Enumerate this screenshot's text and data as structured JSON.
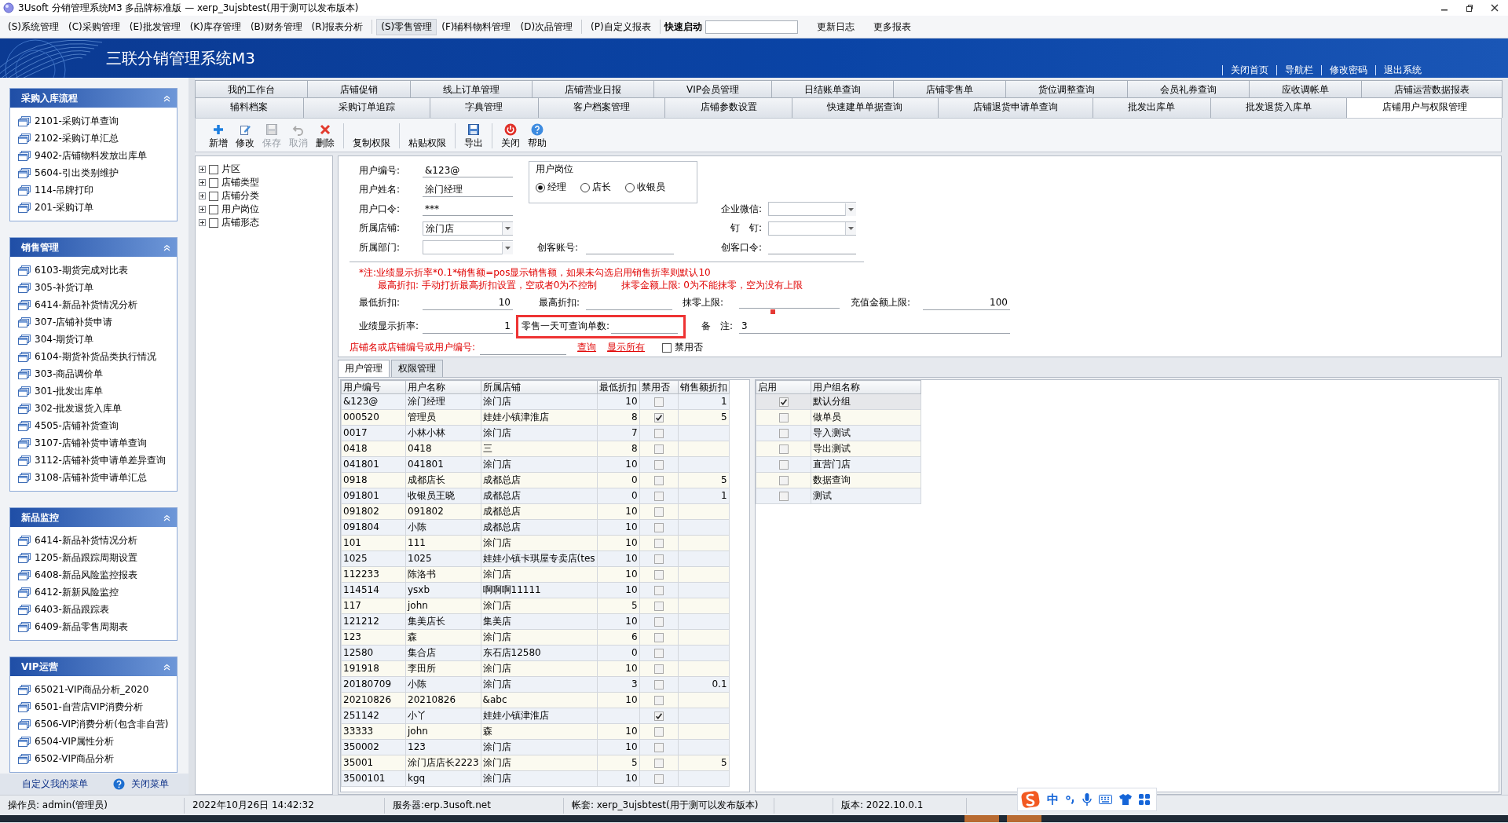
{
  "window": {
    "title": "3Usoft 分销管理系统M3 多品牌标准版 — xerp_3ujsbtest(用于测可以发布版本)"
  },
  "menu_groups": [
    {
      "items": [
        {
          "label": "(S)系统管理",
          "selected": false
        },
        {
          "label": "(C)采购管理",
          "selected": false
        },
        {
          "label": "(E)批发管理",
          "selected": false
        },
        {
          "label": "(K)库存管理",
          "selected": false
        },
        {
          "label": "(B)财务管理",
          "selected": false
        },
        {
          "label": "(R)报表分析",
          "selected": false
        }
      ]
    },
    {
      "items": [
        {
          "label": "(S)零售管理",
          "selected": true
        },
        {
          "label": "(F)辅料物料管理",
          "selected": false
        },
        {
          "label": "(D)次品管理",
          "selected": false
        }
      ]
    },
    {
      "items": [
        {
          "label": "(P)自定义报表",
          "selected": false
        }
      ]
    }
  ],
  "quick_launch": {
    "label": "快速启动"
  },
  "extra_links": [
    "更新日志",
    "更多报表"
  ],
  "header": {
    "title": "三联分销管理系统M3",
    "links": [
      "关闭首页",
      "导航栏",
      "修改密码",
      "退出系统"
    ]
  },
  "sidebar": {
    "panels": [
      {
        "title": "采购入库流程",
        "items": [
          "2101-采购订单查询",
          "2102-采购订单汇总",
          "9402-店铺物料发放出库单",
          "5604-引出类别维护",
          "114-吊牌打印",
          "201-采购订单"
        ]
      },
      {
        "title": "销售管理",
        "items": [
          "6103-期货完成对比表",
          "305-补货订单",
          "6414-新品补货情况分析",
          "307-店铺补货申请",
          "304-期货订单",
          "6104-期货补货品类执行情况",
          "303-商品调价单",
          "301-批发出库单",
          "302-批发退货入库单",
          "4505-店铺补货查询",
          "3107-店铺补货申请单查询",
          "3112-店铺补货申请单差异查询",
          "3108-店铺补货申请单汇总"
        ]
      },
      {
        "title": "新品监控",
        "items": [
          "6414-新品补货情况分析",
          "1205-新品跟踪周期设置",
          "6408-新品风险监控报表",
          "6412-新新风险监控",
          "6403-新品跟踪表",
          "6409-新品零售周期表"
        ]
      },
      {
        "title": "VIP运营",
        "items": [
          "65021-VIP商品分析_2020",
          "6501-自营店VIP消费分析",
          "6506-VIP消费分析(包含非自营)",
          "6504-VIP属性分析",
          "6502-VIP商品分析"
        ]
      }
    ],
    "footer_links": [
      "自定义我的菜单",
      "关闭菜单"
    ]
  },
  "tabs_row1": [
    {
      "label": "我的工作台",
      "selected": false
    },
    {
      "label": "店铺促销",
      "selected": false
    },
    {
      "label": "线上订单管理",
      "selected": false
    },
    {
      "label": "店铺营业日报",
      "selected": false
    },
    {
      "label": "VIP会员管理",
      "selected": false
    },
    {
      "label": "日结账单查询",
      "selected": false
    },
    {
      "label": "店铺零售单",
      "selected": false
    },
    {
      "label": "货位调整查询",
      "selected": false
    },
    {
      "label": "会员礼券查询",
      "selected": false
    },
    {
      "label": "应收调帐单",
      "selected": false
    },
    {
      "label": "店铺运营数据报表",
      "selected": false
    }
  ],
  "tabs_row2": [
    {
      "label": "辅料档案",
      "selected": false
    },
    {
      "label": "采购订单追踪",
      "selected": false
    },
    {
      "label": "字典管理",
      "selected": false
    },
    {
      "label": "客户档案管理",
      "selected": false
    },
    {
      "label": "店铺参数设置",
      "selected": false
    },
    {
      "label": "快速建单单据查询",
      "selected": false
    },
    {
      "label": "店铺退货申请单查询",
      "selected": false
    },
    {
      "label": "批发出库单",
      "selected": false
    },
    {
      "label": "批发退货入库单",
      "selected": false
    },
    {
      "label": "店铺用户与权限管理",
      "selected": true
    }
  ],
  "toolbar": [
    {
      "label": "新增",
      "kind": "icon",
      "disabled": false
    },
    {
      "label": "修改",
      "kind": "icon",
      "disabled": false
    },
    {
      "label": "保存",
      "kind": "icon",
      "disabled": true
    },
    {
      "label": "取消",
      "kind": "icon",
      "disabled": true
    },
    {
      "label": "删除",
      "kind": "icon",
      "disabled": false
    },
    {
      "label": "复制权限",
      "kind": "text",
      "disabled": false
    },
    {
      "label": "粘贴权限",
      "kind": "text",
      "disabled": false
    },
    {
      "label": "导出",
      "kind": "icon",
      "disabled": false
    },
    {
      "label": "关闭",
      "kind": "icon",
      "disabled": false
    },
    {
      "label": "帮助",
      "kind": "icon",
      "disabled": false
    }
  ],
  "tree": [
    {
      "label": "片区",
      "checked": false
    },
    {
      "label": "店铺类型",
      "checked": false
    },
    {
      "label": "店铺分类",
      "checked": false
    },
    {
      "label": "用户岗位",
      "checked": false
    },
    {
      "label": "店铺形态",
      "checked": false
    }
  ],
  "user_form": {
    "fields": [
      {
        "label": "用户编号:",
        "value": "&123@",
        "kind": "text"
      },
      {
        "label": "用户姓名:",
        "value": "涂门经理",
        "kind": "text"
      },
      {
        "label": "用户口令:",
        "value": "***",
        "kind": "text"
      },
      {
        "label": "所属店铺:",
        "value": "涂门店",
        "kind": "dropdown"
      },
      {
        "label": "所属部门:",
        "kind": "dropdown"
      }
    ],
    "position_group": {
      "title": "用户岗位",
      "options": [
        {
          "label": "经理",
          "selected": true
        },
        {
          "label": "店长",
          "selected": false
        },
        {
          "label": "收银员",
          "selected": false
        }
      ]
    },
    "maker_account": {
      "label": "创客账号:"
    },
    "right_fields": [
      {
        "label": "企业微信:",
        "kind": "dropdown"
      },
      {
        "label": "钉　钉:",
        "kind": "dropdown"
      },
      {
        "label": "创客口令:",
        "kind": "text"
      }
    ],
    "notes": [
      "*注:业绩显示折率*0.1*销售额=pos显示销售额，如果未勾选启用销售折率则默认10",
      "最高折扣: 手动打折最高折扣设置，空或者0为不控制",
      "抹零金额上限: 0为不能抹零，空为没有上限"
    ],
    "limits": [
      {
        "label": "最低折扣:",
        "value": "10",
        "kind": "text"
      },
      {
        "label": "最高折扣:",
        "kind": "text"
      },
      {
        "label": "抹零上限:",
        "kind": "slider",
        "level": 0.31
      },
      {
        "label": "充值金额上限:",
        "value": "100",
        "kind": "text"
      }
    ],
    "display_rate": {
      "label": "业绩显示折率:",
      "value": "1"
    },
    "daily_query": {
      "label": "零售一天可查询单数:",
      "highlighted": true
    },
    "remark": {
      "label": "备　注:",
      "value": "3"
    },
    "search": {
      "label": "店铺名或店铺编号或用户编号:",
      "links": [
        "查询",
        "显示所有"
      ],
      "checkbox": {
        "label": "禁用否",
        "checked": false
      }
    }
  },
  "sub_tabs": [
    {
      "label": "用户管理",
      "selected": true
    },
    {
      "label": "权限管理",
      "selected": false
    }
  ],
  "users_table": {
    "columns": [
      "用户编号",
      "用户名称",
      "所属店铺",
      "最低折扣",
      "禁用否",
      "销售额折扣"
    ],
    "rows": [
      {
        "id": "&123@",
        "name": "涂门经理",
        "store": "涂门店",
        "min_discount": "10",
        "disabled": false,
        "sales_discount": "1"
      },
      {
        "id": "000520",
        "name": "管理员",
        "store": "娃娃小镇津淮店",
        "min_discount": "8",
        "disabled": true,
        "sales_discount": "5"
      },
      {
        "id": "0017",
        "name": "小林小林",
        "store": "涂门店",
        "min_discount": "7",
        "disabled": false
      },
      {
        "id": "0418",
        "name": "0418",
        "store": "三",
        "min_discount": "8",
        "disabled": false
      },
      {
        "id": "041801",
        "name": "041801",
        "store": "涂门店",
        "min_discount": "10",
        "disabled": false
      },
      {
        "id": "0918",
        "name": "成都店长",
        "store": "成都总店",
        "min_discount": "0",
        "disabled": false,
        "sales_discount": "5"
      },
      {
        "id": "091801",
        "name": "收银员王晓",
        "store": "成都总店",
        "min_discount": "0",
        "disabled": false,
        "sales_discount": "1"
      },
      {
        "id": "091802",
        "name": "091802",
        "store": "成都总店",
        "min_discount": "10",
        "disabled": false
      },
      {
        "id": "091804",
        "name": "小陈",
        "store": "成都总店",
        "min_discount": "10",
        "disabled": false
      },
      {
        "id": "101",
        "name": "111",
        "store": "涂门店",
        "min_discount": "10",
        "disabled": false
      },
      {
        "id": "1025",
        "name": "1025",
        "store": "娃娃小镇卡琪屋专卖店(tes",
        "min_discount": "10",
        "disabled": false
      },
      {
        "id": "112233",
        "name": "陈洛书",
        "store": "涂门店",
        "min_discount": "10",
        "disabled": false
      },
      {
        "id": "114514",
        "name": "ysxb",
        "store": "啊啊啊11111",
        "min_discount": "10",
        "disabled": false
      },
      {
        "id": "117",
        "name": "john",
        "store": "涂门店",
        "min_discount": "5",
        "disabled": false
      },
      {
        "id": "121212",
        "name": "集美店长",
        "store": "集美店",
        "min_discount": "10",
        "disabled": false
      },
      {
        "id": "123",
        "name": "森",
        "store": "涂门店",
        "min_discount": "6",
        "disabled": false
      },
      {
        "id": "12580",
        "name": "集合店",
        "store": "东石店12580",
        "min_discount": "0",
        "disabled": false
      },
      {
        "id": "191918",
        "name": "李田所",
        "store": "涂门店",
        "min_discount": "10",
        "disabled": false
      },
      {
        "id": "20180709",
        "name": "小陈",
        "store": "涂门店",
        "min_discount": "3",
        "disabled": false,
        "sales_discount": "0.1"
      },
      {
        "id": "20210826",
        "name": "20210826",
        "store": "&abc",
        "min_discount": "10",
        "disabled": false
      },
      {
        "id": "251142",
        "name": "小丫",
        "store": "娃娃小镇津淮店",
        "disabled": true
      },
      {
        "id": "33333",
        "name": "john",
        "store": "森",
        "min_discount": "10",
        "disabled": false
      },
      {
        "id": "350002",
        "name": "123",
        "store": "涂门店",
        "min_discount": "10",
        "disabled": false
      },
      {
        "id": "35001",
        "name": "涂门店店长2223",
        "store": "涂门店",
        "min_discount": "5",
        "disabled": false,
        "sales_discount": "5"
      },
      {
        "id": "3500101",
        "name": "kgq",
        "store": "涂门店",
        "min_discount": "10",
        "disabled": false
      }
    ]
  },
  "groups_table": {
    "columns": [
      "启用",
      "用户组名称"
    ],
    "rows": [
      {
        "enabled": true,
        "name": "默认分组",
        "selected": true
      },
      {
        "enabled": false,
        "name": "做单员",
        "selected": false
      },
      {
        "enabled": false,
        "name": "导入测试",
        "selected": false
      },
      {
        "enabled": false,
        "name": "导出测试",
        "selected": false
      },
      {
        "enabled": false,
        "name": "直营门店",
        "selected": false
      },
      {
        "enabled": false,
        "name": "数据查询",
        "selected": false
      },
      {
        "enabled": false,
        "name": "测试",
        "selected": false
      }
    ]
  },
  "status_bar": [
    "操作员: admin(管理员)",
    "2022年10月26日 14:42:32",
    "服务器:erp.3usoft.net",
    "帐套: xerp_3ujsbtest(用于测可以发布版本)",
    "版本: 2022.10.0.1"
  ],
  "ime": {
    "mode": "中"
  }
}
